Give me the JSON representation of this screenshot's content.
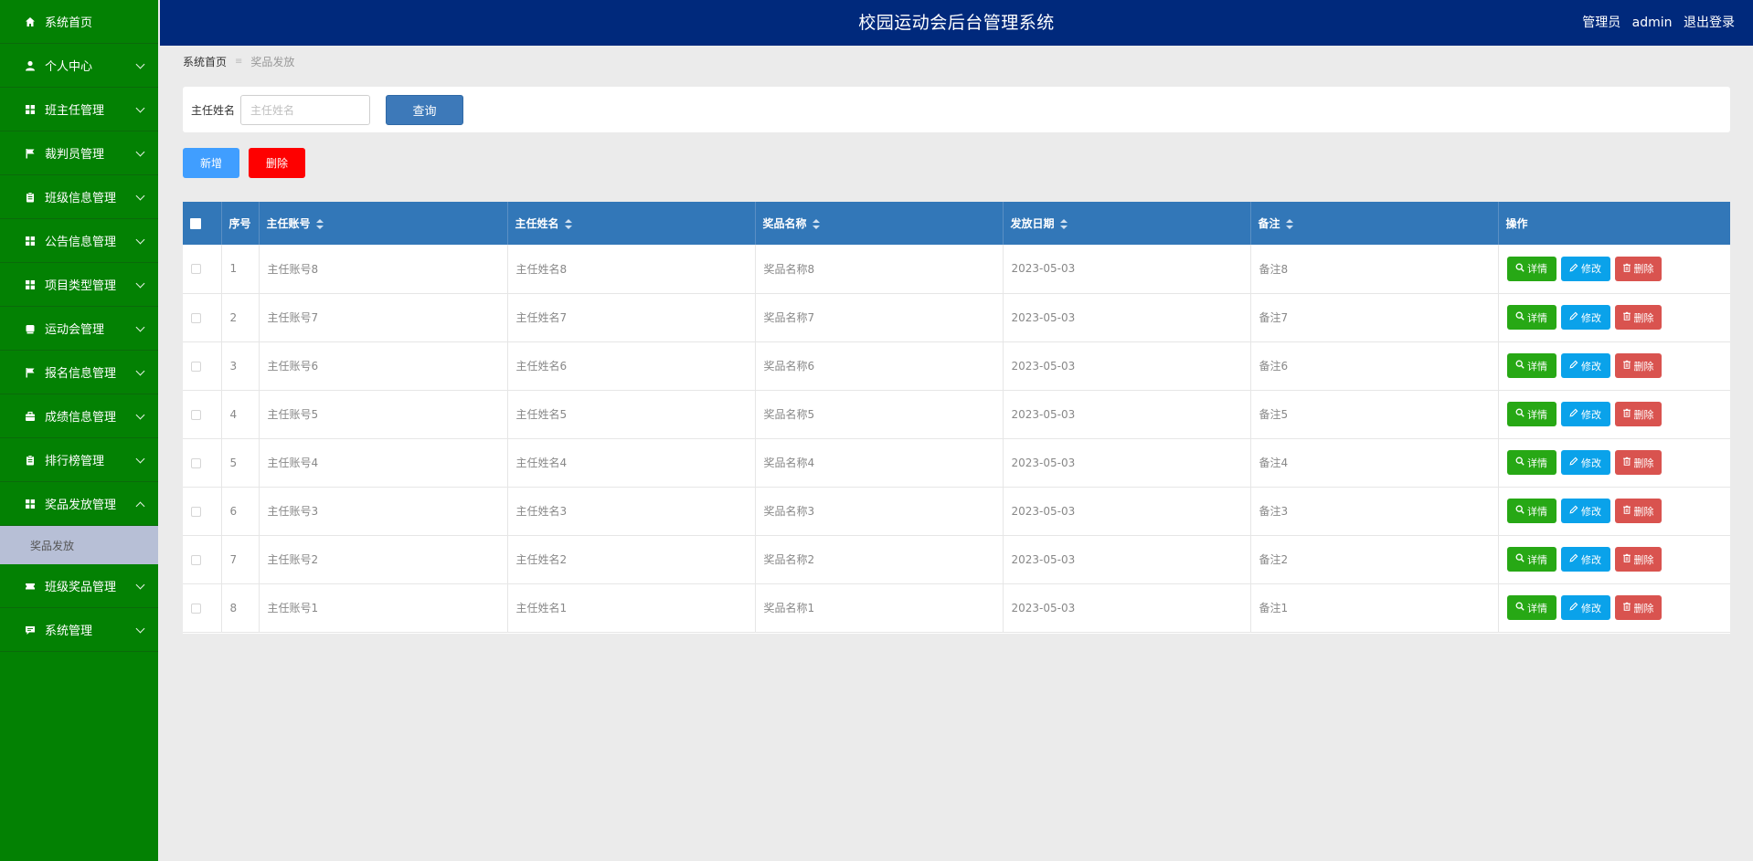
{
  "header": {
    "title": "校园运动会后台管理系统",
    "role": "管理员",
    "username": "admin",
    "logout": "退出登录"
  },
  "sidebar": {
    "items": [
      {
        "label": "系统首页",
        "icon": "home-icon",
        "arrow": false
      },
      {
        "label": "个人中心",
        "icon": "user-icon",
        "arrow": true
      },
      {
        "label": "班主任管理",
        "icon": "grid-icon",
        "arrow": true
      },
      {
        "label": "裁判员管理",
        "icon": "flag-icon",
        "arrow": true
      },
      {
        "label": "班级信息管理",
        "icon": "clipboard-icon",
        "arrow": true
      },
      {
        "label": "公告信息管理",
        "icon": "grid-icon",
        "arrow": true
      },
      {
        "label": "项目类型管理",
        "icon": "grid-icon",
        "arrow": true
      },
      {
        "label": "运动会管理",
        "icon": "drive-icon",
        "arrow": true
      },
      {
        "label": "报名信息管理",
        "icon": "flag-icon",
        "arrow": true
      },
      {
        "label": "成绩信息管理",
        "icon": "briefcase-icon",
        "arrow": true
      },
      {
        "label": "排行榜管理",
        "icon": "clipboard-icon",
        "arrow": true
      },
      {
        "label": "奖品发放管理",
        "icon": "grid-icon",
        "arrow": true,
        "expanded": true
      },
      {
        "label": "班级奖品管理",
        "icon": "ticket-icon",
        "arrow": true
      },
      {
        "label": "系统管理",
        "icon": "chat-icon",
        "arrow": true
      }
    ],
    "submenu": {
      "label": "奖品发放"
    }
  },
  "breadcrumb": {
    "home": "系统首页",
    "separator": "≡",
    "current": "奖品发放"
  },
  "search": {
    "label": "主任姓名",
    "placeholder": "主任姓名",
    "value": "",
    "button": "查询"
  },
  "actions": {
    "add": "新增",
    "delete": "删除"
  },
  "table": {
    "columns": [
      "序号",
      "主任账号",
      "主任姓名",
      "奖品名称",
      "发放日期",
      "备注",
      "操作"
    ],
    "rows": [
      {
        "index": "1",
        "account": "主任账号8",
        "name": "主任姓名8",
        "prize": "奖品名称8",
        "date": "2023-05-03",
        "note": "备注8"
      },
      {
        "index": "2",
        "account": "主任账号7",
        "name": "主任姓名7",
        "prize": "奖品名称7",
        "date": "2023-05-03",
        "note": "备注7"
      },
      {
        "index": "3",
        "account": "主任账号6",
        "name": "主任姓名6",
        "prize": "奖品名称6",
        "date": "2023-05-03",
        "note": "备注6"
      },
      {
        "index": "4",
        "account": "主任账号5",
        "name": "主任姓名5",
        "prize": "奖品名称5",
        "date": "2023-05-03",
        "note": "备注5"
      },
      {
        "index": "5",
        "account": "主任账号4",
        "name": "主任姓名4",
        "prize": "奖品名称4",
        "date": "2023-05-03",
        "note": "备注4"
      },
      {
        "index": "6",
        "account": "主任账号3",
        "name": "主任姓名3",
        "prize": "奖品名称3",
        "date": "2023-05-03",
        "note": "备注3"
      },
      {
        "index": "7",
        "account": "主任账号2",
        "name": "主任姓名2",
        "prize": "奖品名称2",
        "date": "2023-05-03",
        "note": "备注2"
      },
      {
        "index": "8",
        "account": "主任账号1",
        "name": "主任姓名1",
        "prize": "奖品名称1",
        "date": "2023-05-03",
        "note": "备注1"
      }
    ],
    "row_actions": {
      "detail": "详情",
      "edit": "修改",
      "delete": "删除"
    }
  },
  "colors": {
    "sidebar_bg": "#038103",
    "header_bg": "#00297c",
    "table_header_bg": "#3277b8",
    "add_button": "#409eff",
    "delete_button": "#fe0000",
    "detail_button": "#27a815",
    "edit_button": "#0aa2ea",
    "row_delete_button": "#d9534f"
  }
}
